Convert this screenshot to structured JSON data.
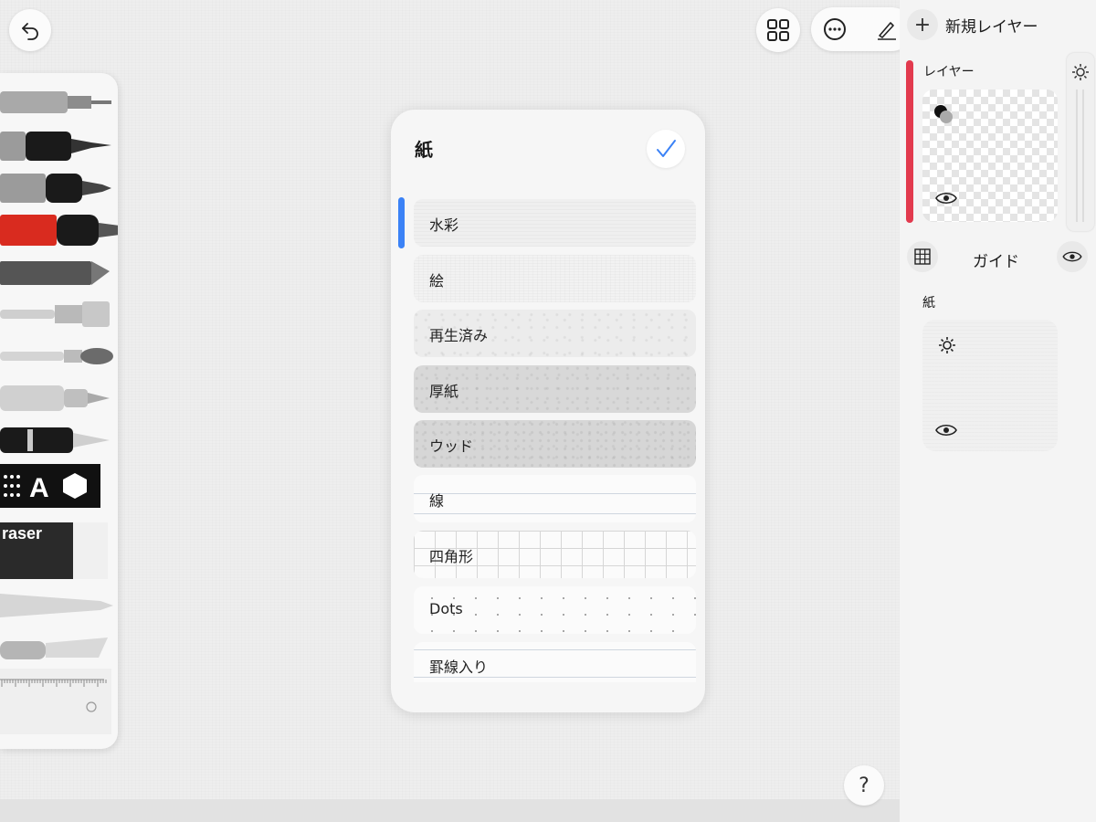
{
  "toolbar": {
    "undo_icon": "undo-arrow-icon",
    "gallery_icon": "grid-icon",
    "more_icon": "ellipsis-icon",
    "sign_icon": "pen-sign-icon"
  },
  "tools": [
    {
      "name": "technical-pen"
    },
    {
      "name": "fineliner"
    },
    {
      "name": "marker"
    },
    {
      "name": "brush-pen"
    },
    {
      "name": "pastel"
    },
    {
      "name": "flat-brush"
    },
    {
      "name": "round-brush"
    },
    {
      "name": "fountain-pen-silver"
    },
    {
      "name": "fountain-pen-black"
    },
    {
      "name": "text-shapes-tool"
    },
    {
      "name": "eraser",
      "label": "raser"
    },
    {
      "name": "blender"
    },
    {
      "name": "cutter"
    },
    {
      "name": "ruler"
    }
  ],
  "paper_panel": {
    "title": "紙",
    "selected_index": 0,
    "items": [
      {
        "label": "水彩",
        "texture": "watercolor"
      },
      {
        "label": "絵",
        "texture": "art"
      },
      {
        "label": "再生済み",
        "texture": "recycled"
      },
      {
        "label": "厚紙",
        "texture": "thick"
      },
      {
        "label": "ウッド",
        "texture": "wood"
      },
      {
        "label": "線",
        "texture": "lines"
      },
      {
        "label": "四角形",
        "texture": "squares"
      },
      {
        "label": "Dots",
        "texture": "dots"
      },
      {
        "label": "罫線入り",
        "texture": "ruled"
      }
    ]
  },
  "layers": {
    "new_layer_label": "新規レイヤー",
    "layer_title": "レイヤー",
    "guide_label": "ガイド",
    "paper_label": "紙",
    "accent_color": "#e23a4e"
  },
  "help_label": "?"
}
